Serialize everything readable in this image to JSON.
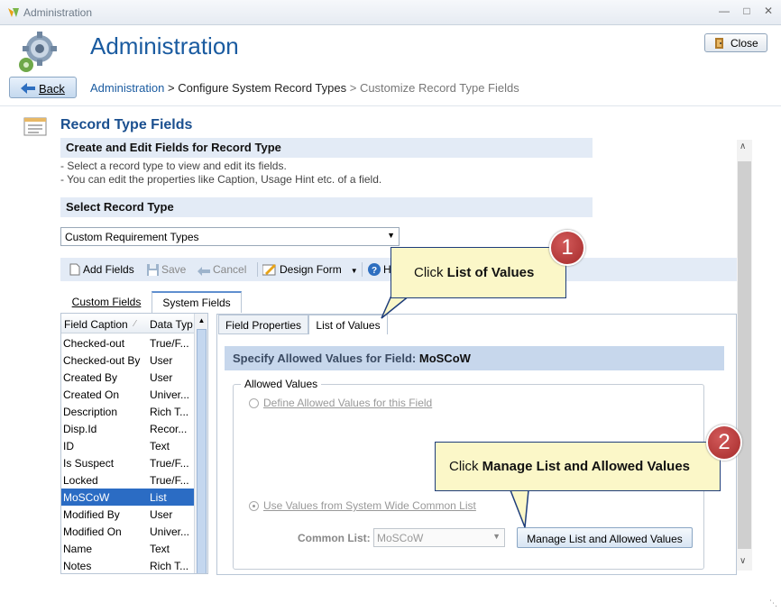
{
  "window": {
    "title": "Administration",
    "min_icon": "minimize-icon",
    "max_icon": "maximize-icon",
    "close_icon": "close-icon"
  },
  "header": {
    "title": "Administration",
    "close_label": "Close",
    "back_label": "Back"
  },
  "breadcrumb": {
    "root": "Administration",
    "sep1": " > ",
    "middle": "Configure System Record Types",
    "sep2": " > ",
    "current": "Customize Record Type Fields"
  },
  "record_type_fields": {
    "title": "Record Type Fields",
    "section_title": "Create and Edit Fields for Record Type",
    "help": [
      "-  Select a record type to view and edit its fields.",
      "-  You can edit the properties like Caption, Usage Hint etc. of a field."
    ],
    "select_title": "Select Record Type",
    "selected_record_type": "Custom Requirement Types"
  },
  "toolbar": {
    "add_fields": "Add Fields",
    "save": "Save",
    "cancel": "Cancel",
    "design_form": "Design Form",
    "help": "H"
  },
  "field_tabs": [
    "Custom Fields",
    "System Fields"
  ],
  "field_list": {
    "col_caption": "Field Caption",
    "col_type": "Data Typ",
    "rows": [
      {
        "caption": "Checked-out",
        "type": "True/F..."
      },
      {
        "caption": "Checked-out By",
        "type": "User"
      },
      {
        "caption": "Created By",
        "type": "User"
      },
      {
        "caption": "Created On",
        "type": "Univer..."
      },
      {
        "caption": "Description",
        "type": "Rich T..."
      },
      {
        "caption": "Disp.Id",
        "type": "Recor..."
      },
      {
        "caption": "ID",
        "type": "Text"
      },
      {
        "caption": "Is Suspect",
        "type": "True/F..."
      },
      {
        "caption": "Locked",
        "type": "True/F..."
      },
      {
        "caption": "MoSCoW",
        "type": "List"
      },
      {
        "caption": "Modified By",
        "type": "User"
      },
      {
        "caption": "Modified On",
        "type": "Univer..."
      },
      {
        "caption": "Name",
        "type": "Text"
      },
      {
        "caption": "Notes",
        "type": "Rich T..."
      }
    ],
    "selected_index": 9
  },
  "detail_tabs": [
    "Field Properties",
    "List of Values"
  ],
  "allowed_values": {
    "heading_prefix": "Specify Allowed Values for Field: ",
    "field_name": "MoSCoW",
    "group_label": "Allowed Values",
    "option_define": "Define Allowed Values for this Field",
    "option_use": "Use Values from System Wide Common List",
    "common_list_label": "Common List:",
    "common_list_value": "MoSCoW",
    "manage_button": "Manage List and Allowed Values"
  },
  "callouts": [
    {
      "number": "1",
      "prefix": "Click ",
      "bold": "List of Values"
    },
    {
      "number": "2",
      "prefix": "Click ",
      "bold": "Manage List and Allowed Values"
    }
  ],
  "colors": {
    "title_blue": "#1a5ba0",
    "selection": "#2b6cc4",
    "callout_fill": "#fbf7c8",
    "badge_red": "#a52a2a"
  }
}
